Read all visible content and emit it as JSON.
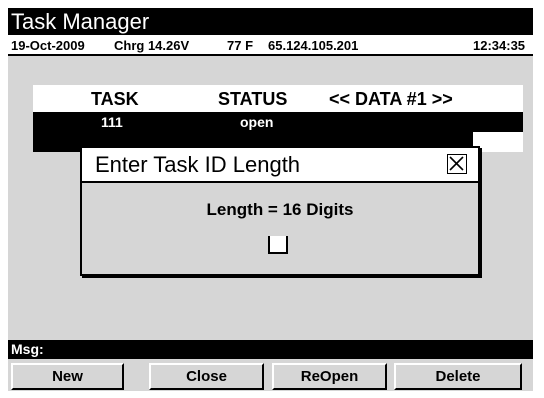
{
  "app": {
    "title": "Task Manager"
  },
  "status": {
    "date": "19-Oct-2009",
    "charge": "Chrg 14.26V",
    "temp": "77 F",
    "ip": "65.124.105.201",
    "time": "12:34:35"
  },
  "table": {
    "headers": [
      "TASK",
      "STATUS",
      "<< DATA #1 >>"
    ],
    "rows": [
      {
        "task": "111",
        "status": "open"
      }
    ]
  },
  "dialog": {
    "title": "Enter Task ID Length",
    "message": "Length = 16 Digits",
    "close_icon": "close-icon"
  },
  "msgbar": {
    "label": "Msg:"
  },
  "buttons": [
    "New",
    "Close",
    "ReOpen",
    "Delete"
  ],
  "colors": {
    "background": "#d6d6d6",
    "bar": "#000000",
    "panel": "#ffffff"
  }
}
